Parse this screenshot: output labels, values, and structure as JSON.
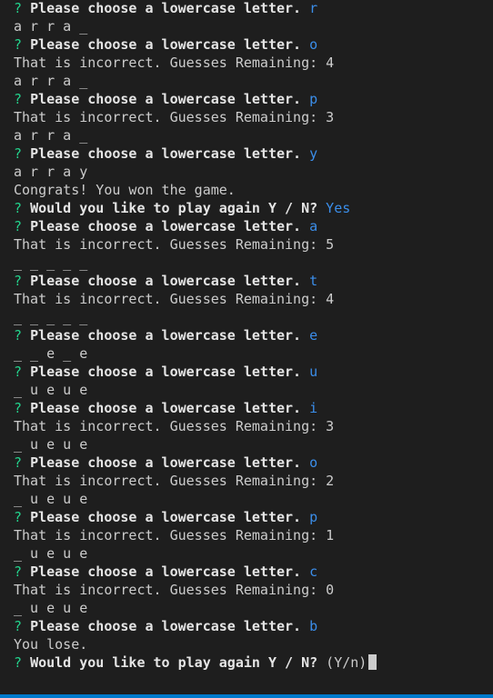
{
  "terminal": {
    "lines": [
      {
        "kind": "prompt",
        "q": "?",
        "text": "Please choose a lowercase letter.",
        "answer": "r"
      },
      {
        "kind": "output",
        "text": "a r r a _"
      },
      {
        "kind": "prompt",
        "q": "?",
        "text": "Please choose a lowercase letter.",
        "answer": "o"
      },
      {
        "kind": "output",
        "text": "That is incorrect. Guesses Remaining: 4"
      },
      {
        "kind": "output",
        "text": "a r r a _"
      },
      {
        "kind": "prompt",
        "q": "?",
        "text": "Please choose a lowercase letter.",
        "answer": "p"
      },
      {
        "kind": "output",
        "text": "That is incorrect. Guesses Remaining: 3"
      },
      {
        "kind": "output",
        "text": "a r r a _"
      },
      {
        "kind": "prompt",
        "q": "?",
        "text": "Please choose a lowercase letter.",
        "answer": "y"
      },
      {
        "kind": "output",
        "text": "a r r a y"
      },
      {
        "kind": "output",
        "text": "Congrats! You won the game."
      },
      {
        "kind": "prompt",
        "q": "?",
        "text": "Would you like to play again Y / N?",
        "answer": "Yes"
      },
      {
        "kind": "prompt",
        "q": "?",
        "text": "Please choose a lowercase letter.",
        "answer": "a"
      },
      {
        "kind": "output",
        "text": "That is incorrect. Guesses Remaining: 5"
      },
      {
        "kind": "output",
        "text": "_ _ _ _ _"
      },
      {
        "kind": "prompt",
        "q": "?",
        "text": "Please choose a lowercase letter.",
        "answer": "t"
      },
      {
        "kind": "output",
        "text": "That is incorrect. Guesses Remaining: 4"
      },
      {
        "kind": "output",
        "text": "_ _ _ _ _"
      },
      {
        "kind": "prompt",
        "q": "?",
        "text": "Please choose a lowercase letter.",
        "answer": "e"
      },
      {
        "kind": "output",
        "text": "_ _ e _ e"
      },
      {
        "kind": "prompt",
        "q": "?",
        "text": "Please choose a lowercase letter.",
        "answer": "u"
      },
      {
        "kind": "output",
        "text": "_ u e u e"
      },
      {
        "kind": "prompt",
        "q": "?",
        "text": "Please choose a lowercase letter.",
        "answer": "i"
      },
      {
        "kind": "output",
        "text": "That is incorrect. Guesses Remaining: 3"
      },
      {
        "kind": "output",
        "text": "_ u e u e"
      },
      {
        "kind": "prompt",
        "q": "?",
        "text": "Please choose a lowercase letter.",
        "answer": "o"
      },
      {
        "kind": "output",
        "text": "That is incorrect. Guesses Remaining: 2"
      },
      {
        "kind": "output",
        "text": "_ u e u e"
      },
      {
        "kind": "prompt",
        "q": "?",
        "text": "Please choose a lowercase letter.",
        "answer": "p"
      },
      {
        "kind": "output",
        "text": "That is incorrect. Guesses Remaining: 1"
      },
      {
        "kind": "output",
        "text": "_ u e u e"
      },
      {
        "kind": "prompt",
        "q": "?",
        "text": "Please choose a lowercase letter.",
        "answer": "c"
      },
      {
        "kind": "output",
        "text": "That is incorrect. Guesses Remaining: 0"
      },
      {
        "kind": "output",
        "text": "_ u e u e"
      },
      {
        "kind": "prompt",
        "q": "?",
        "text": "Please choose a lowercase letter.",
        "answer": "b"
      },
      {
        "kind": "output",
        "text": "You lose."
      },
      {
        "kind": "active",
        "q": "?",
        "text": "Would you like to play again Y / N?",
        "hint": "(Y/n)"
      }
    ]
  },
  "colors": {
    "background": "#1e1e1e",
    "prompt_marker": "#23d18b",
    "answer": "#3b8eea",
    "output": "#cccccc",
    "status_bar": "#007acc"
  }
}
